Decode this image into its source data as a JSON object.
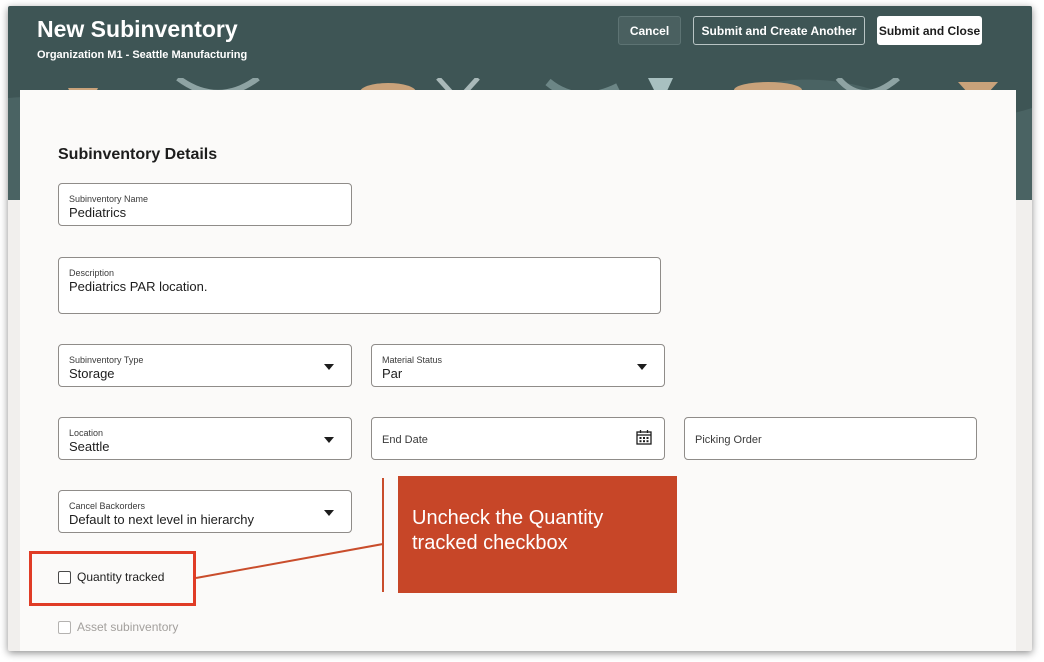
{
  "header": {
    "title": "New Subinventory",
    "subtitle": "Organization M1 - Seattle Manufacturing",
    "buttons": {
      "cancel": "Cancel",
      "submit_another": "Submit and Create Another",
      "submit_close": "Submit and Close"
    }
  },
  "section": {
    "title": "Subinventory Details"
  },
  "fields": {
    "subinventory_name": {
      "label": "Subinventory Name",
      "value": "Pediatrics"
    },
    "description": {
      "label": "Description",
      "value": "Pediatrics PAR location."
    },
    "subinventory_type": {
      "label": "Subinventory Type",
      "value": "Storage"
    },
    "material_status": {
      "label": "Material Status",
      "value": "Par"
    },
    "location": {
      "label": "Location",
      "value": "Seattle"
    },
    "end_date": {
      "label": "End Date",
      "value": ""
    },
    "picking_order": {
      "label": "Picking Order",
      "value": ""
    },
    "cancel_backorders": {
      "label": "Cancel Backorders",
      "value": "Default to next level in hierarchy"
    }
  },
  "checkboxes": {
    "quantity_tracked": {
      "label": "Quantity tracked",
      "checked": false
    },
    "asset_subinventory": {
      "label": "Asset subinventory",
      "checked": false,
      "disabled": true
    }
  },
  "callout": {
    "text": "Uncheck the Quantity tracked checkbox"
  },
  "colors": {
    "header": "#3e5555",
    "callout": "#c74628",
    "highlight": "#e03c26"
  }
}
